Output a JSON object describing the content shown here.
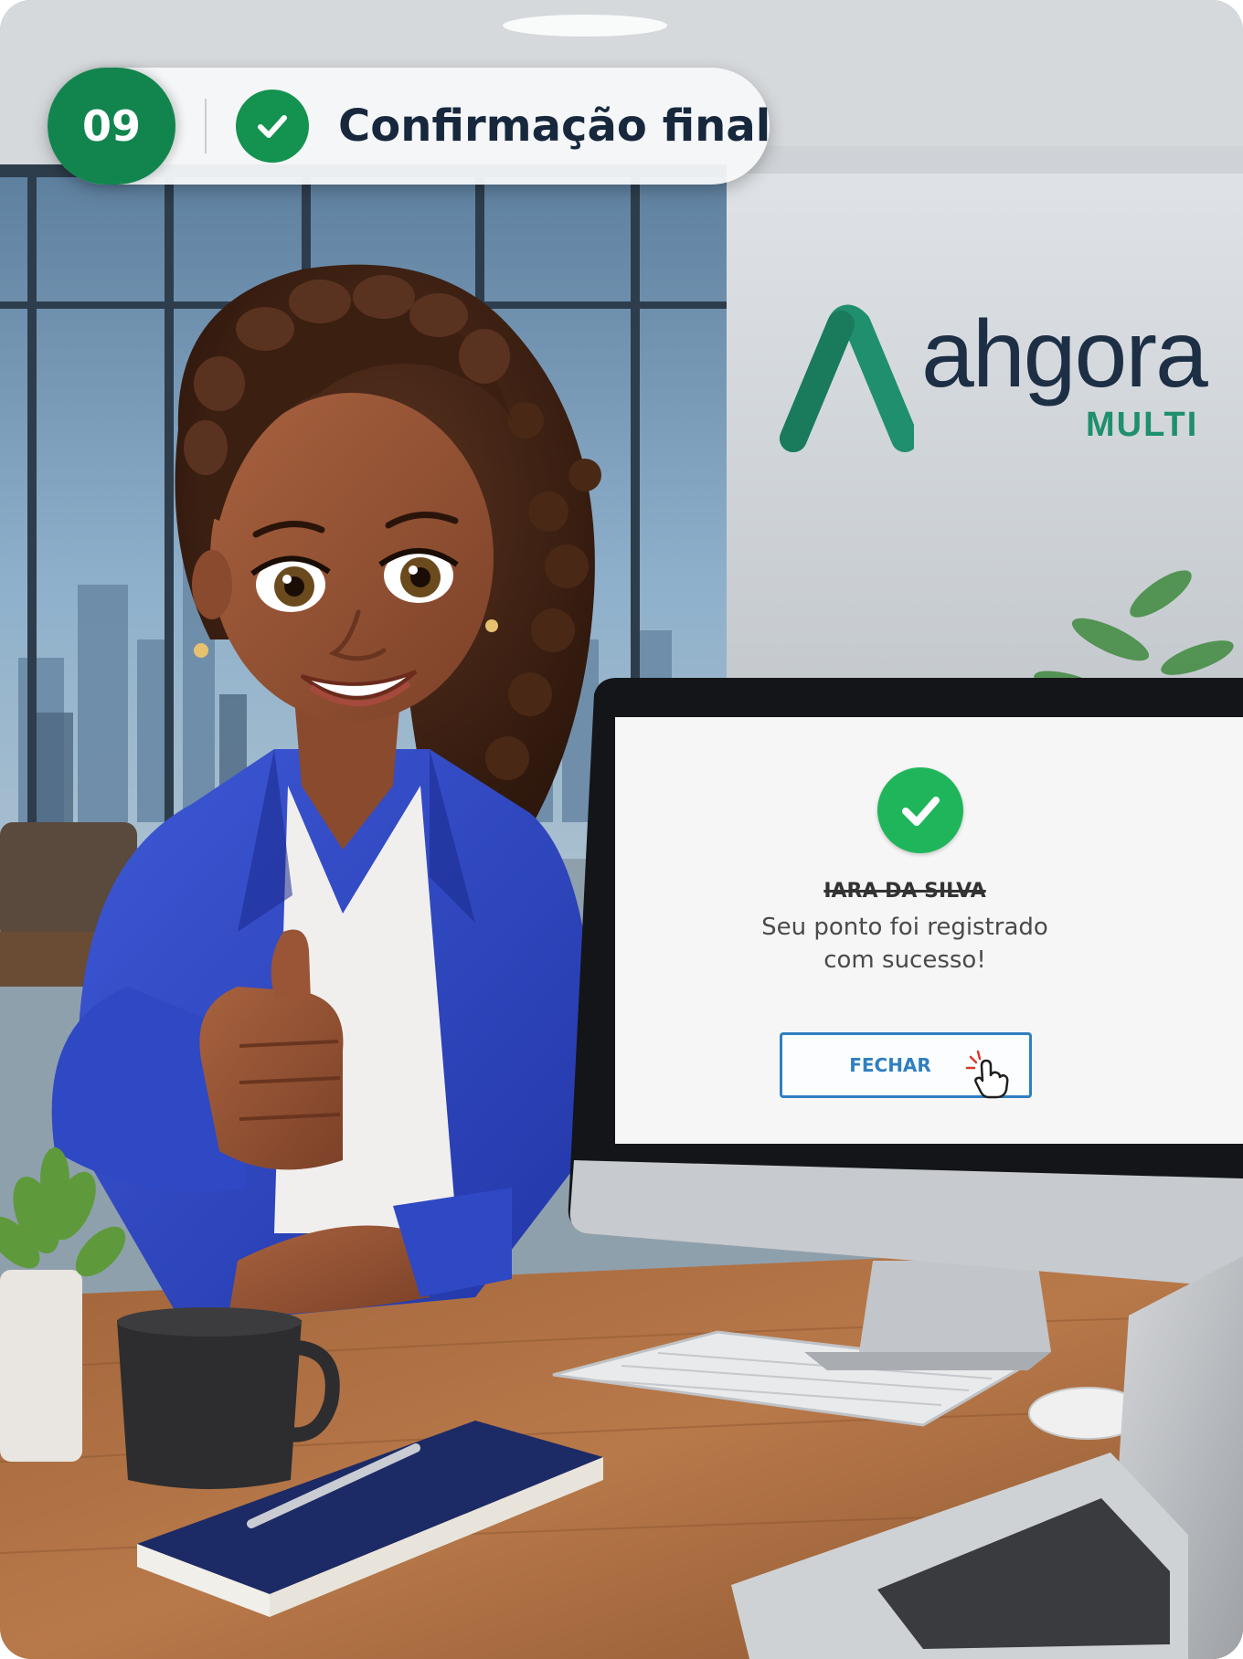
{
  "step": {
    "number": "09",
    "title": "Confirmação final",
    "check_icon": "check-circle-icon",
    "accent": "#12854e"
  },
  "brand": {
    "name": "ahgora",
    "subtitle": "MULTI",
    "logo_icon": "ahgora-logo-icon",
    "color": "#1f8f6d"
  },
  "screen": {
    "status_icon": "check-circle-icon",
    "user_name": "IARA DA SILVA",
    "message_line1": "Seu ponto foi registrado",
    "message_line2": "com sucesso!",
    "close_button": "FECHAR",
    "cursor_icon": "hand-pointer-icon",
    "success_color": "#1fb65b",
    "button_color": "#2f7fc1"
  }
}
